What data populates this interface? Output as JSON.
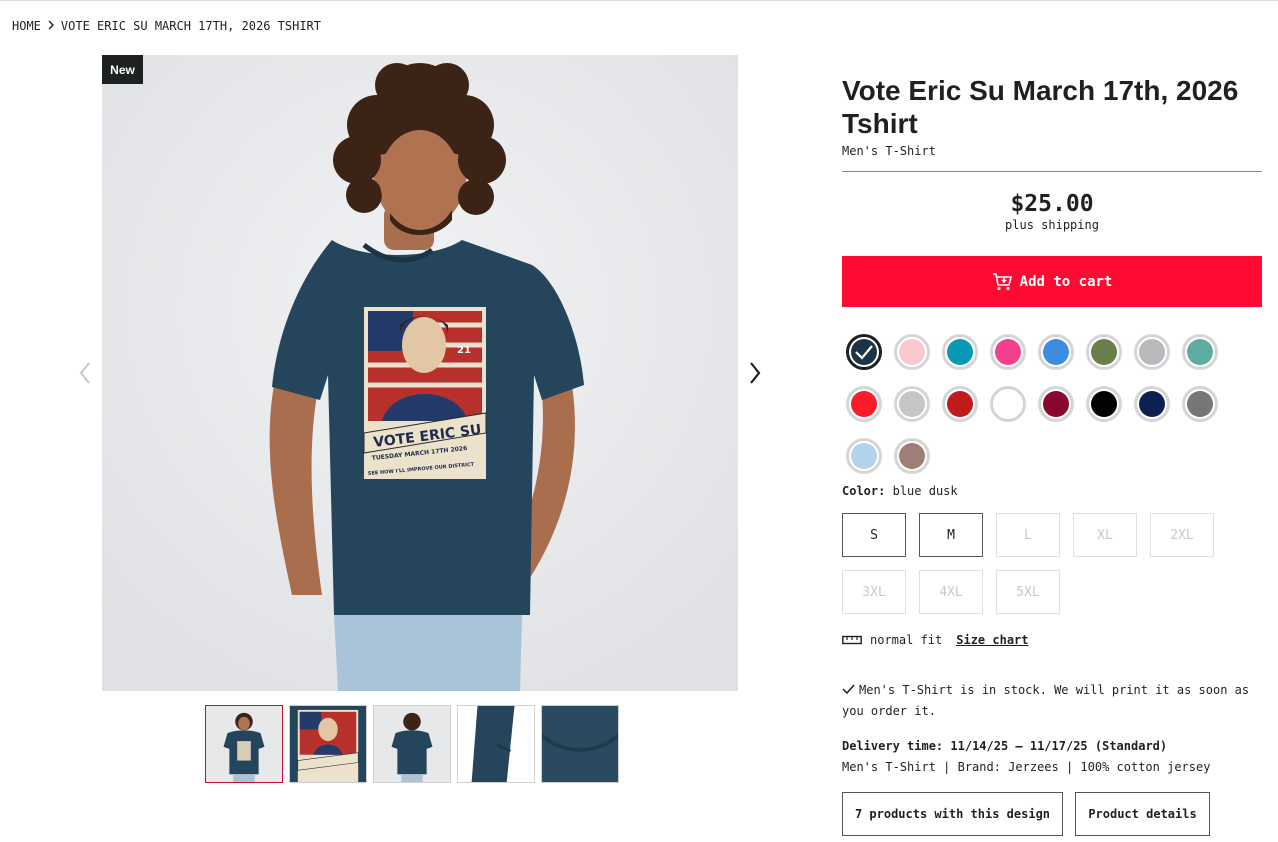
{
  "breadcrumb": {
    "home": "HOME",
    "current": "VOTE ERIC SU MARCH 17TH, 2026 TSHIRT"
  },
  "image": {
    "badge": "New"
  },
  "product": {
    "title": "Vote Eric Su March 17th, 2026 Tshirt",
    "subtitle": "Men's T-Shirt",
    "price": "$25.00",
    "shipping": "plus shipping",
    "add_to_cart": "Add to cart"
  },
  "colors": {
    "label": "Color:",
    "selected": "blue dusk",
    "swatches": [
      "#1b3445",
      "#f9c7ce",
      "#0a98b6",
      "#f5408c",
      "#3d8ede",
      "#6a7f4c",
      "#b7b9bc",
      "#5dada0",
      "#fb1c2a",
      "#c6c6c8",
      "#c11a1d",
      "#ffffff",
      "#890830",
      "#020202",
      "#0e1f52",
      "#767676",
      "#b3d3ec",
      "#a07e78"
    ]
  },
  "sizes": [
    {
      "label": "S",
      "available": true
    },
    {
      "label": "M",
      "available": true
    },
    {
      "label": "L",
      "available": false
    },
    {
      "label": "XL",
      "available": false
    },
    {
      "label": "2XL",
      "available": false
    },
    {
      "label": "3XL",
      "available": false
    },
    {
      "label": "4XL",
      "available": false
    },
    {
      "label": "5XL",
      "available": false
    }
  ],
  "fit": {
    "label": "normal fit",
    "size_chart": "Size chart"
  },
  "stock": {
    "text": "Men's T-Shirt is in stock. We will print it as soon as you order it."
  },
  "delivery": {
    "label": "Delivery time:",
    "value": "11/14/25 – 11/17/25 (Standard)"
  },
  "details_line": "Men's T-Shirt | Brand: Jerzees | 100% cotton jersey",
  "buttons": {
    "products": "7 products with this design",
    "details": "Product details"
  },
  "print": {
    "headline": "VOTE ERIC SU",
    "line1": "TUESDAY MARCH 17TH 2026",
    "line2": "SEE HOW I'LL IMPROVE OUR DISTRICT",
    "district": "21"
  },
  "theme": {
    "accent": "#ff0a32",
    "thumb_active": "#c8102e",
    "text": "#1d2121"
  }
}
